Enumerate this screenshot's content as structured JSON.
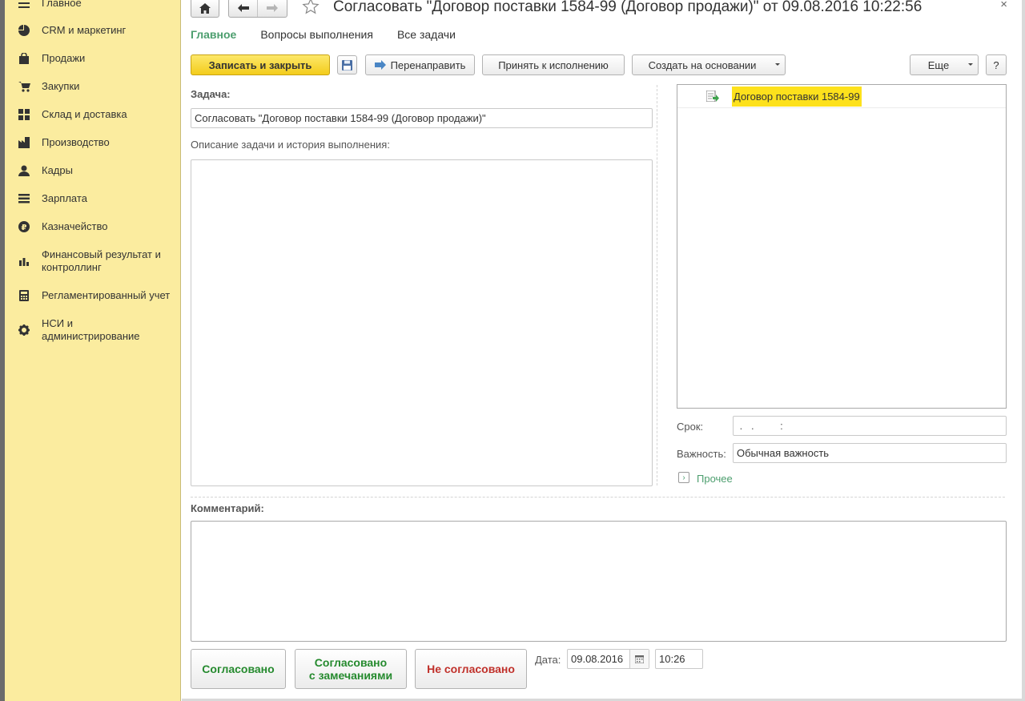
{
  "sidebar": {
    "items": [
      {
        "label": "Главное",
        "icon": "menu-icon"
      },
      {
        "label": "CRM и маркетинг",
        "icon": "pie-chart-icon"
      },
      {
        "label": "Продажи",
        "icon": "shopping-bag-icon"
      },
      {
        "label": "Закупки",
        "icon": "cart-icon"
      },
      {
        "label": "Склад и доставка",
        "icon": "grid-icon"
      },
      {
        "label": "Производство",
        "icon": "factory-icon"
      },
      {
        "label": "Кадры",
        "icon": "person-icon"
      },
      {
        "label": "Зарплата",
        "icon": "lines-icon"
      },
      {
        "label": "Казначейство",
        "icon": "ruble-icon"
      },
      {
        "label": "Финансовый результат и контроллинг",
        "icon": "bar-chart-icon"
      },
      {
        "label": "Регламентированный учет",
        "icon": "calculator-icon"
      },
      {
        "label": "НСИ и администрирование",
        "icon": "gear-icon"
      }
    ]
  },
  "header": {
    "title": "Согласовать \"Договор поставки 1584-99 (Договор продажи)\" от 09.08.2016 10:22:56",
    "close": "×"
  },
  "tabs": [
    {
      "label": "Главное",
      "active": true
    },
    {
      "label": "Вопросы выполнения",
      "active": false
    },
    {
      "label": "Все задачи",
      "active": false
    }
  ],
  "toolbar": {
    "save_close": "Записать и закрыть",
    "redirect": "Перенаправить",
    "accept": "Принять к исполнению",
    "create_based": "Создать на основании",
    "more": "Еще",
    "help": "?"
  },
  "task": {
    "label": "Задача:",
    "value": "Согласовать \"Договор поставки 1584-99 (Договор продажи)\"",
    "description_label": "Описание задачи и история выполнения:"
  },
  "tree": {
    "item": "Договор поставки 1584-99"
  },
  "deadline": {
    "label": "Срок:",
    "value": " .   .         :"
  },
  "importance": {
    "label": "Важность:",
    "value": "Обычная важность"
  },
  "other": {
    "label": "Прочее"
  },
  "comment": {
    "label": "Комментарий:"
  },
  "actions": {
    "approved": "Согласовано",
    "approved_remarks_line1": "Согласовано",
    "approved_remarks_line2": "с замечаниями",
    "not_approved": "Не согласовано"
  },
  "date": {
    "label": "Дата:",
    "value": "09.08.2016",
    "time": "10:26"
  },
  "colors": {
    "sidebar_bg": "#fbec9f",
    "accent_green": "#4c9e6e",
    "primary_yellow": "#f3cc1b",
    "highlight": "#fde11c",
    "approve_green": "#258a2e",
    "reject_red": "#c0302a"
  }
}
